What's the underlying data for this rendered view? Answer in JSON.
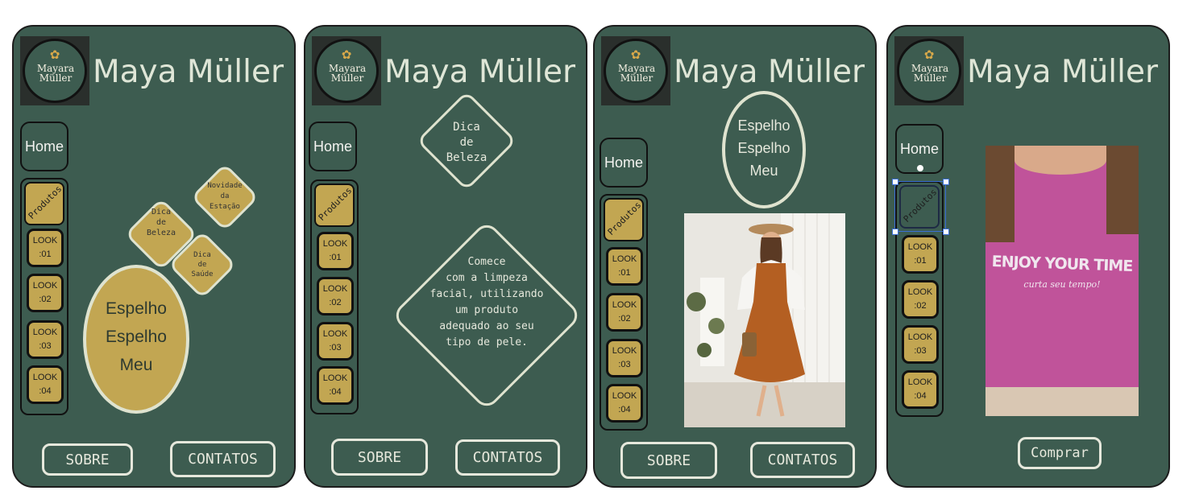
{
  "brand": {
    "name": "Maya Müller",
    "logo_line1": "Mayara",
    "logo_line2": "Müller",
    "logo_icon": "flower-icon"
  },
  "nav": {
    "home": "Home",
    "produtos": "Produtos",
    "looks": [
      "LOOK\n:01",
      "LOOK\n:02",
      "LOOK\n:03",
      "LOOK\n:04"
    ]
  },
  "footer": {
    "sobre": "SOBRE",
    "contatos": "CONTATOS",
    "comprar": "Comprar"
  },
  "screen1": {
    "dica_beleza": "Dica\nde\nBeleza",
    "novidade": "Novidade\nda\nEstação",
    "dica_saude": "Dica\nde\nSaúde",
    "espelho": "Espelho\nEspelho\nMeu"
  },
  "screen2": {
    "dica_beleza": "Dica\nde\nBeleza",
    "tip": "Comece\ncom a limpeza\nfacial, utilizando\num produto\nadequado ao seu\ntipo de pele."
  },
  "screen3": {
    "espelho": "Espelho\nEspelho\nMeu",
    "photo_icon": "dress-photo"
  },
  "screen4": {
    "shirt_text": "ENJOY YOUR TIME",
    "shirt_subtext": "curta seu tempo!",
    "photo_icon": "tshirt-photo"
  },
  "colors": {
    "background": "#3d5c50",
    "gold": "#c2a652",
    "light": "#e6e8dc",
    "shirt": "#c0539a"
  }
}
